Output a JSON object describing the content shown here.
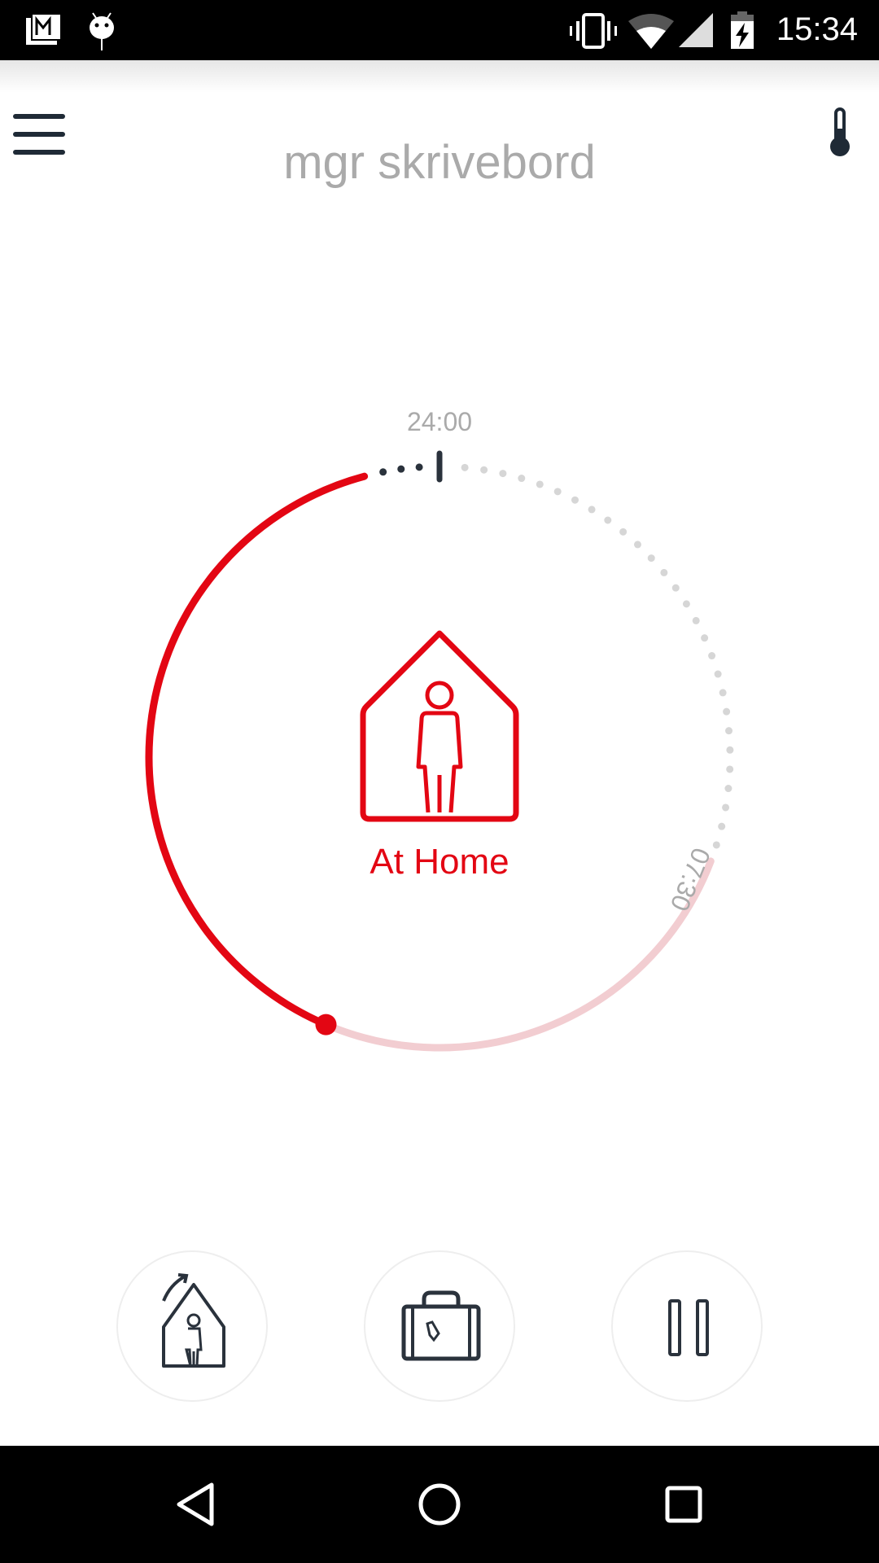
{
  "status_bar": {
    "time": "15:34",
    "left_icons": [
      "gmail-icon",
      "android-debug-icon"
    ],
    "right_icons": [
      "vibrate-icon",
      "wifi-icon",
      "cell-signal-icon",
      "battery-charging-icon"
    ]
  },
  "header": {
    "title": "mgr skrivebord",
    "menu_icon": "hamburger-menu-icon",
    "right_icon": "thermometer-icon"
  },
  "dial": {
    "top_label": "24:00",
    "end_label": "07:30",
    "mode_label": "At Home",
    "mode_icon": "home-person-icon",
    "colors": {
      "active": "#e30613",
      "remaining": "#f2cdd1",
      "dots": "#d6d6d6",
      "marker": "#2a323c"
    }
  },
  "actions": [
    {
      "icon": "leave-home-icon"
    },
    {
      "icon": "suitcase-away-icon"
    },
    {
      "icon": "pause-icon"
    }
  ],
  "nav_bar": {
    "buttons": [
      "back-icon",
      "home-icon",
      "recents-icon"
    ]
  }
}
